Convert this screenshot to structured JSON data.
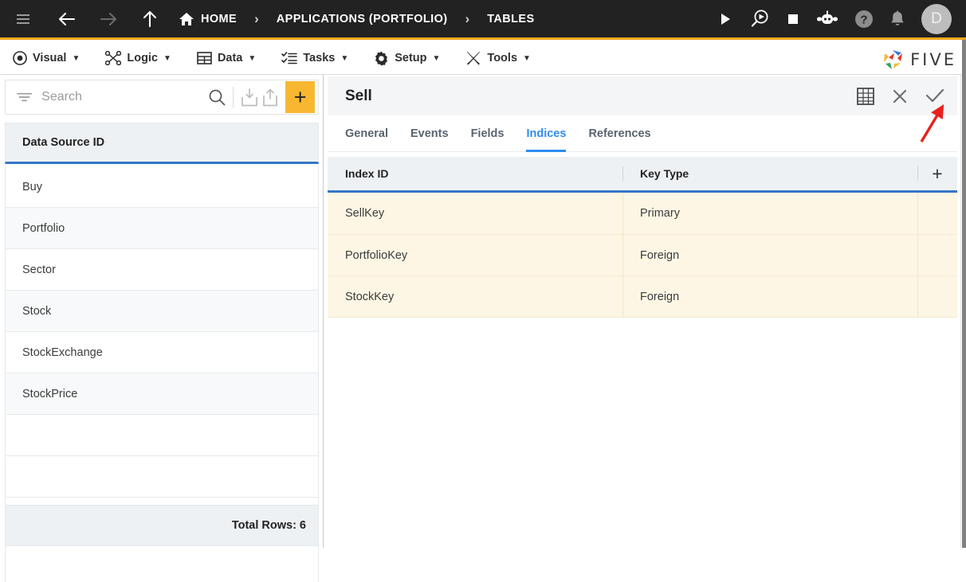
{
  "topbar": {
    "icons_left": [
      "hamburger-icon",
      "back-arrow-icon",
      "forward-arrow-icon",
      "up-arrow-icon"
    ],
    "breadcrumb": [
      {
        "label": "HOME",
        "icon": "home-icon"
      },
      {
        "label": "APPLICATIONS (PORTFOLIO)",
        "icon": ""
      },
      {
        "label": "TABLES",
        "icon": ""
      }
    ],
    "separator": "›",
    "icons_right": [
      "play-icon",
      "debug-icon",
      "stop-icon",
      "robot-icon",
      "help-icon",
      "bell-icon"
    ],
    "avatar_initial": "D",
    "accent_color": "#f0a71c",
    "background": "#222222"
  },
  "menubar": {
    "items": [
      {
        "label": "Visual",
        "icon": "eye-icon",
        "caret": "▼"
      },
      {
        "label": "Logic",
        "icon": "nodes-icon",
        "caret": "▼"
      },
      {
        "label": "Data",
        "icon": "table-icon",
        "caret": "▼"
      },
      {
        "label": "Tasks",
        "icon": "checklist-icon",
        "caret": "▼"
      },
      {
        "label": "Setup",
        "icon": "gear-icon",
        "caret": "▼"
      },
      {
        "label": "Tools",
        "icon": "tools-icon",
        "caret": "▼"
      }
    ],
    "brand": "FIVE"
  },
  "sidebar": {
    "search": {
      "value": "",
      "placeholder": "Search"
    },
    "toolbar_icons": [
      "filter-icon",
      "search-icon",
      "import-icon",
      "export-icon"
    ],
    "add_label": "+",
    "column_header": "Data Source ID",
    "rows": [
      {
        "label": "Buy"
      },
      {
        "label": "Portfolio"
      },
      {
        "label": "Sector"
      },
      {
        "label": "Stock"
      },
      {
        "label": "StockExchange"
      },
      {
        "label": "StockPrice"
      }
    ],
    "footer": "Total Rows: 6"
  },
  "detail": {
    "title": "Sell",
    "header_icons": [
      "grid-view-icon",
      "close-icon",
      "save-check-icon"
    ],
    "tabs": [
      {
        "label": "General",
        "active": false
      },
      {
        "label": "Events",
        "active": false
      },
      {
        "label": "Fields",
        "active": false
      },
      {
        "label": "Indices",
        "active": true
      },
      {
        "label": "References",
        "active": false
      }
    ],
    "grid": {
      "columns": [
        "Index ID",
        "Key Type"
      ],
      "add_label": "+",
      "rows": [
        {
          "index_id": "SellKey",
          "key_type": "Primary"
        },
        {
          "index_id": "PortfolioKey",
          "key_type": "Foreign"
        },
        {
          "index_id": "StockKey",
          "key_type": "Foreign"
        }
      ]
    }
  },
  "annotation": {
    "type": "red-arrow",
    "points_to": "save-check-icon",
    "color": "#e8211c"
  }
}
